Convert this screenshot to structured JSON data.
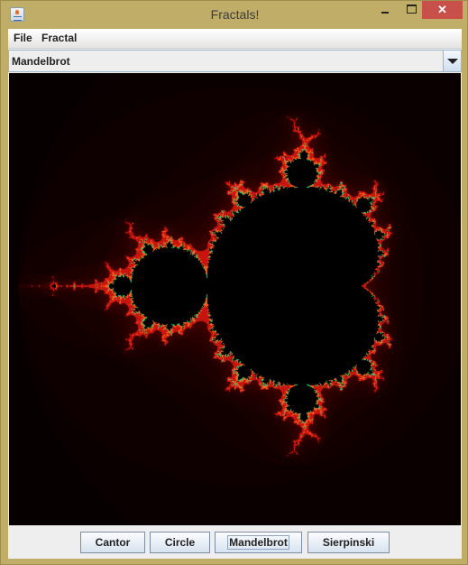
{
  "window": {
    "title": "Fractals!",
    "close_glyph": "✕"
  },
  "menubar": {
    "items": [
      {
        "label": "File"
      },
      {
        "label": "Fractal"
      }
    ]
  },
  "selector": {
    "selected": "Mandelbrot"
  },
  "buttons": [
    {
      "label": "Cantor"
    },
    {
      "label": "Circle"
    },
    {
      "label": "Mandelbrot",
      "focused": true
    },
    {
      "label": "Sierpinski"
    }
  ],
  "fractal": {
    "type": "Mandelbrot",
    "center_re": -0.565,
    "center_im": 0.0,
    "max_iterations": 60,
    "colors": {
      "interior": "#000000",
      "edge_high": "#2fd68a",
      "edge_mid": "#ff5a1a",
      "glow": "#8a0c0c"
    }
  }
}
